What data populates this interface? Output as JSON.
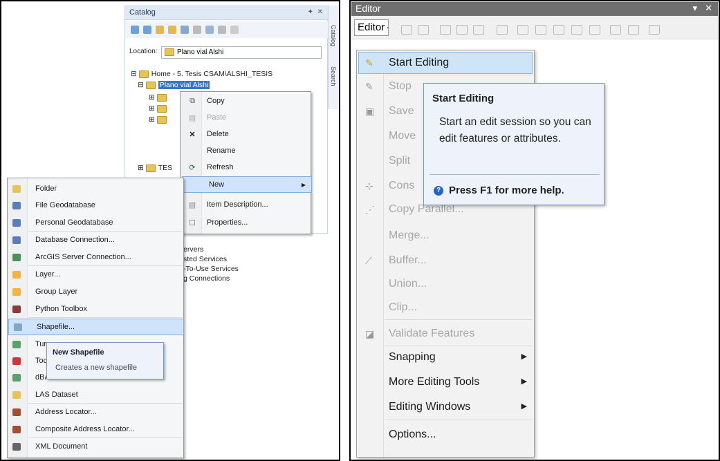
{
  "catalog": {
    "title": "Catalog",
    "side_tabs": [
      "Catalog",
      "Search"
    ],
    "location_label": "Location:",
    "location_value": "Plano vial Alshi",
    "tree": [
      {
        "label": "Home - 5. Tesis CSAM\\ALSHI_TESIS"
      },
      {
        "label": "Plano vial Alshi"
      },
      {
        "label": "TES"
      }
    ],
    "partial_text": [
      "ervers",
      "sted Services",
      "-To-Use Services",
      "g Connections"
    ]
  },
  "context_menu_1": {
    "items": [
      {
        "label": "Copy",
        "icon": "copy-icon",
        "disabled": false
      },
      {
        "label": "Paste",
        "icon": "paste-icon",
        "disabled": true
      },
      {
        "label": "Delete",
        "icon": "delete-icon",
        "disabled": false
      },
      {
        "label": "Rename",
        "icon": "",
        "disabled": false
      },
      {
        "label": "Refresh",
        "icon": "refresh-icon",
        "disabled": false
      },
      {
        "label": "New",
        "icon": "",
        "disabled": false,
        "submenu": true,
        "highlighted": true
      },
      {
        "label": "Item Description...",
        "icon": "item-description-icon",
        "disabled": false
      },
      {
        "label": "Properties...",
        "icon": "properties-icon",
        "disabled": false
      }
    ]
  },
  "new_submenu": {
    "items": [
      {
        "label": "Folder",
        "icon": "folder-icon",
        "color": "#e8c35c"
      },
      {
        "label": "File Geodatabase",
        "icon": "file-geodatabase-icon",
        "color": "#5a7fb8"
      },
      {
        "label": "Personal Geodatabase",
        "icon": "personal-geodatabase-icon",
        "color": "#5a7fb8"
      },
      {
        "label": "Database Connection...",
        "icon": "database-connection-icon",
        "color": "#5a7fb8"
      },
      {
        "label": "ArcGIS Server Connection...",
        "icon": "arcgis-server-icon",
        "color": "#4a8f5c"
      },
      {
        "label": "Layer...",
        "icon": "layer-icon",
        "color": "#f2b640"
      },
      {
        "label": "Group Layer",
        "icon": "group-layer-icon",
        "color": "#f2b640"
      },
      {
        "label": "Python Toolbox",
        "icon": "python-toolbox-icon",
        "color": "#8a3a3a"
      },
      {
        "label": "Shapefile...",
        "icon": "shapefile-icon",
        "color": "#7fa8c9",
        "highlighted": true
      },
      {
        "label": "Tur",
        "icon": "turn-feature-class-icon",
        "color": "#5a9f6c"
      },
      {
        "label": "Toc",
        "icon": "toolbox-icon",
        "color": "#c8383c"
      },
      {
        "label": "dBA",
        "icon": "dbase-table-icon",
        "color": "#5a9f6c"
      },
      {
        "label": "LAS Dataset",
        "icon": "las-dataset-icon",
        "color": "#e8c35c"
      },
      {
        "label": "Address Locator...",
        "icon": "address-locator-icon",
        "color": "#a05030"
      },
      {
        "label": "Composite Address Locator...",
        "icon": "composite-locator-icon",
        "color": "#a05030"
      },
      {
        "label": "XML Document",
        "icon": "xml-document-icon",
        "color": "#666666"
      }
    ],
    "tooltip_title": "New Shapefile",
    "tooltip_desc": "Creates a new shapefile"
  },
  "editor": {
    "window_title": "Editor",
    "dropdown_label": "Editor",
    "menu": [
      {
        "label": "Start Editing",
        "icon": "start-editing-icon",
        "disabled": false,
        "highlighted": true
      },
      {
        "label": "Stop",
        "icon": "stop-editing-icon",
        "disabled": true
      },
      {
        "label": "Save",
        "icon": "save-edits-icon",
        "disabled": true
      },
      {
        "label": "Move",
        "icon": "",
        "disabled": true
      },
      {
        "label": "Split",
        "icon": "",
        "disabled": true
      },
      {
        "label": "Cons",
        "icon": "construct-points-icon",
        "disabled": true
      },
      {
        "label": "Copy Parallel...",
        "icon": "copy-parallel-icon",
        "disabled": true
      },
      {
        "label": "Merge...",
        "icon": "",
        "disabled": true
      },
      {
        "label": "Buffer...",
        "icon": "buffer-icon",
        "disabled": true
      },
      {
        "label": "Union...",
        "icon": "",
        "disabled": true
      },
      {
        "label": "Clip...",
        "icon": "",
        "disabled": true
      },
      {
        "label": "Validate Features",
        "icon": "validate-features-icon",
        "disabled": true
      },
      {
        "label": "Snapping",
        "icon": "",
        "disabled": false,
        "submenu": true
      },
      {
        "label": "More Editing Tools",
        "icon": "",
        "disabled": false,
        "submenu": true
      },
      {
        "label": "Editing Windows",
        "icon": "",
        "disabled": false,
        "submenu": true
      },
      {
        "label": "Options...",
        "icon": "",
        "disabled": false
      }
    ],
    "tooltip": {
      "title": "Start Editing",
      "description": "Start an edit session so you can edit features or attributes.",
      "help": "Press F1 for more help."
    }
  }
}
